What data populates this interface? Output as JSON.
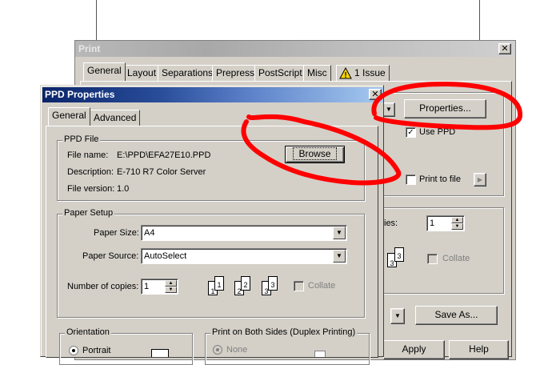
{
  "print_window": {
    "title": "Print",
    "tabs": [
      "General",
      "Layout",
      "Separations",
      "Prepress",
      "PostScript",
      "Misc",
      "1 Issue"
    ],
    "properties_label": "Properties...",
    "use_ppd_label": "Use PPD",
    "print_to_file_label": "Print to file",
    "copies_label": "ies:",
    "copies_value": "1",
    "collate_label": "Collate",
    "save_as_label": "Save As...",
    "apply_label": "Apply",
    "help_label": "Help"
  },
  "ppd_window": {
    "title": "PPD Properties",
    "tabs": [
      "General",
      "Advanced"
    ],
    "ppd_file": {
      "group_label": "PPD File",
      "file_name_label": "File name:",
      "file_name_value": "E:\\PPD\\EFA27E10.PPD",
      "description_label": "Description:",
      "description_value": "E-710 R7 Color Server",
      "file_version_label": "File version:",
      "file_version_value": "1.0",
      "browse_label": "Browse"
    },
    "paper_setup": {
      "group_label": "Paper Setup",
      "paper_size_label": "Paper Size:",
      "paper_size_value": "A4",
      "paper_source_label": "Paper Source:",
      "paper_source_value": "AutoSelect",
      "copies_label": "Number of copies:",
      "copies_value": "1",
      "collate_label": "Collate"
    },
    "orientation": {
      "group_label": "Orientation",
      "portrait_label": "Portrait"
    },
    "duplex": {
      "group_label": "Print on Both Sides (Duplex Printing)",
      "none_label": "None"
    }
  },
  "annotation_color": "#ff0000"
}
